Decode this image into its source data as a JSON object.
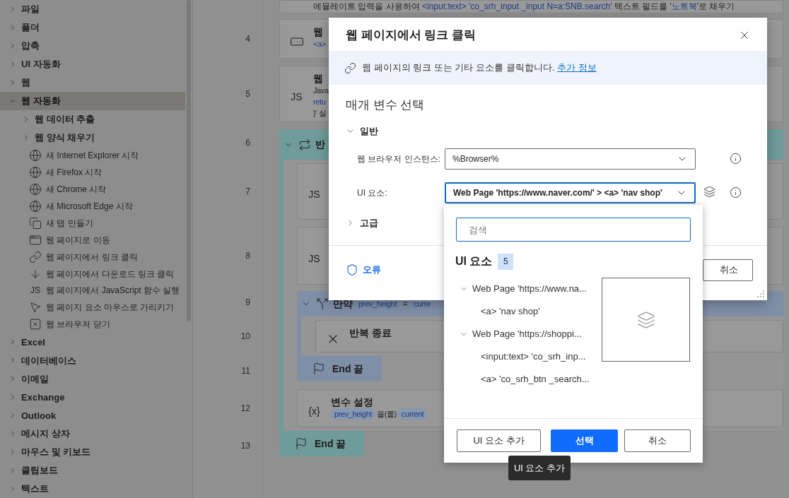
{
  "sidebar": {
    "items": [
      {
        "label": "파일",
        "kind": "group",
        "expanded": false,
        "selected": false
      },
      {
        "label": "폴더",
        "kind": "group",
        "expanded": false,
        "selected": false
      },
      {
        "label": "압축",
        "kind": "group",
        "expanded": false,
        "selected": false
      },
      {
        "label": "UI 자동화",
        "kind": "group",
        "expanded": false,
        "selected": false
      },
      {
        "label": "웹",
        "kind": "group",
        "expanded": false,
        "selected": false
      },
      {
        "label": "웹 자동화",
        "kind": "group",
        "expanded": true,
        "selected": true,
        "children": [
          {
            "label": "웹 데이터 추출",
            "kind": "group",
            "expanded": false,
            "selected": false
          },
          {
            "label": "웹 양식 채우기",
            "kind": "group",
            "expanded": false,
            "selected": false
          },
          {
            "label": "새 Internet Explorer 시작",
            "kind": "action",
            "selected": false
          },
          {
            "label": "새 Firefox 시작",
            "kind": "action",
            "selected": false
          },
          {
            "label": "새 Chrome 시작",
            "kind": "action",
            "selected": false
          },
          {
            "label": "새 Microsoft Edge 시작",
            "kind": "action",
            "selected": false
          },
          {
            "label": "새 탭 만들기",
            "kind": "action",
            "selected": false
          },
          {
            "label": "웹 페이지로 이동",
            "kind": "action",
            "selected": false
          },
          {
            "label": "웹 페이지에서 링크 클릭",
            "kind": "action",
            "selected": false
          },
          {
            "label": "웹 페이지에서 다운로드 링크 클릭",
            "kind": "action",
            "selected": false
          },
          {
            "label": "웹 페이지에서 JavaScript 함수 실행",
            "kind": "action",
            "glyph": "JS",
            "selected": false
          },
          {
            "label": "웹 페이지 요소 마우스로 가리키기",
            "kind": "action",
            "selected": false
          },
          {
            "label": "웹 브라우저 닫기",
            "kind": "action",
            "selected": false
          }
        ]
      },
      {
        "label": "Excel",
        "kind": "group",
        "expanded": false,
        "selected": false
      },
      {
        "label": "데이터베이스",
        "kind": "group",
        "expanded": false,
        "selected": false
      },
      {
        "label": "이메일",
        "kind": "group",
        "expanded": false,
        "selected": false
      },
      {
        "label": "Exchange",
        "kind": "group",
        "expanded": false,
        "selected": false
      },
      {
        "label": "Outlook",
        "kind": "group",
        "expanded": false,
        "selected": false
      },
      {
        "label": "메시지 상자",
        "kind": "group",
        "expanded": false,
        "selected": false
      },
      {
        "label": "마우스 및 키보드",
        "kind": "group",
        "expanded": false,
        "selected": false
      },
      {
        "label": "클립보드",
        "kind": "group",
        "expanded": false,
        "selected": false
      },
      {
        "label": "텍스트",
        "kind": "group",
        "expanded": false,
        "selected": false
      }
    ]
  },
  "flow": {
    "steps": [
      {
        "kind": "action",
        "lines": [
          [
            {
              "text": "에뮬레이트 입력을 사용하여 ",
              "kind": "plain"
            },
            {
              "text": "<input:text> 'co_srh_input _input N=a:SNB.search'",
              "kind": "code"
            },
            {
              "text": " 텍스트 필드를 '",
              "kind": "plain"
            },
            {
              "text": "노트북",
              "kind": "code"
            },
            {
              "text": "'로 채우기",
              "kind": "plain"
            }
          ]
        ]
      },
      {
        "number": "4",
        "kind": "action",
        "title": "웹",
        "lines": [
          [
            {
              "text": "<a>",
              "kind": "code"
            }
          ]
        ]
      },
      {
        "number": "5",
        "kind": "action",
        "glyph": "JS",
        "title": "웹",
        "lines": [
          [
            {
              "text": "Java",
              "kind": "plain"
            }
          ],
          [
            {
              "text": "retu",
              "kind": "code"
            }
          ],
          [
            {
              "text": "}' 실",
              "kind": "plain"
            }
          ]
        ]
      },
      {
        "number": "6",
        "kind": "loop",
        "title": "반",
        "expanded": true,
        "children": [
          {
            "number": "7",
            "kind": "action",
            "glyph": "JS"
          },
          {
            "number": "8",
            "kind": "action",
            "glyph": "JS"
          },
          {
            "number": "9",
            "kind": "if",
            "title": "만약",
            "expanded": true,
            "condition": [
              {
                "text": "prev_height",
                "kind": "code"
              },
              {
                "text": "=",
                "kind": "plain"
              },
              {
                "text": "curre",
                "kind": "code"
              }
            ],
            "children": [
              {
                "number": "10",
                "kind": "action",
                "title": "반복 종료"
              }
            ],
            "end": {
              "number": "11",
              "label": "End 끝"
            }
          },
          {
            "number": "12",
            "kind": "action",
            "glyph": "{x}",
            "title": "변수 설정",
            "lines": [
              [
                {
                  "text": "prev_height",
                  "kind": "pill"
                },
                {
                  "text": "을(를)",
                  "kind": "plain"
                },
                {
                  "text": "current",
                  "kind": "pill"
                }
              ]
            ]
          }
        ],
        "end": {
          "number": "13",
          "label": "End 끝"
        }
      }
    ]
  },
  "dialog": {
    "title": "웹 페이지에서 링크 클릭",
    "info": {
      "text": "웹 페이지의 링크 또는 기타 요소를 클릭합니다.",
      "link": "추가 정보"
    },
    "section_title": "매개 변수 선택",
    "groups": [
      {
        "label": "일반",
        "expanded": true,
        "fields": [
          {
            "label": "웹 브라우저 인스턴스:",
            "value": "%Browser%",
            "focused": false,
            "picker": false
          },
          {
            "label": "UI 요소:",
            "value": "Web Page 'https://www.naver.com/' > <a> 'nav shop'",
            "focused": true,
            "picker": true
          }
        ]
      },
      {
        "label": "고급",
        "expanded": false
      }
    ],
    "status": "오류",
    "cancel": "취소"
  },
  "element_picker": {
    "search": {
      "placeholder": "검색"
    },
    "heading": "UI 요소",
    "count": "5",
    "tree": [
      {
        "label": "Web Page 'https://www.na...",
        "expanded": true,
        "selected": false,
        "children": [
          {
            "label": "<a> 'nav shop'",
            "selected": false
          }
        ]
      },
      {
        "label": "Web Page 'https://shoppi...",
        "expanded": true,
        "selected": false,
        "children": [
          {
            "label": "<input:text> 'co_srh_inp...",
            "selected": false
          },
          {
            "label": "<a> 'co_srh_btn _search...",
            "selected": false
          }
        ]
      }
    ],
    "buttons": [
      {
        "label": "UI 요소 추가",
        "kind": "secondary"
      },
      {
        "label": "선택",
        "kind": "primary"
      },
      {
        "label": "취소",
        "kind": "secondary"
      }
    ],
    "tooltip": "UI 요소 추가"
  }
}
